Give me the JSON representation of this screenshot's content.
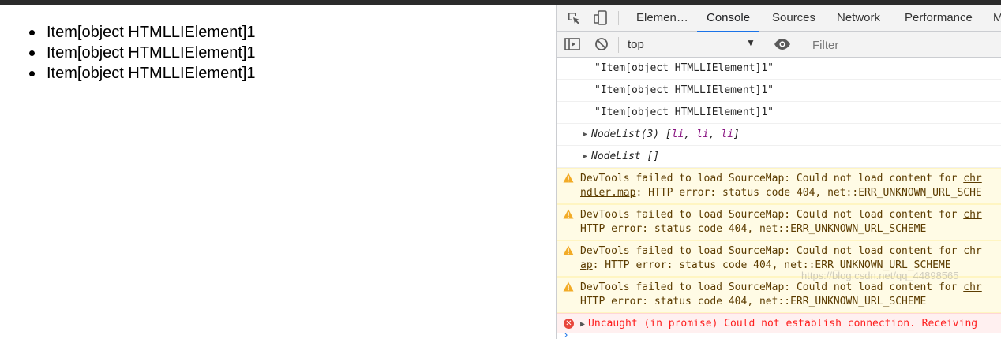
{
  "page": {
    "list_items": [
      "Item[object HTMLLIElement]1",
      "Item[object HTMLLIElement]1",
      "Item[object HTMLLIElement]1"
    ]
  },
  "devtools": {
    "tabs": [
      "Elemen…",
      "Console",
      "Sources",
      "Network",
      "Performance",
      "M"
    ],
    "active_tab": "Console",
    "context_selector": "top",
    "filter_placeholder": "Filter",
    "accent_color": "#1a73e8"
  },
  "console": {
    "strings": [
      "\"Item[object HTMLLIElement]1\"",
      "\"Item[object HTMLLIElement]1\"",
      "\"Item[object HTMLLIElement]1\""
    ],
    "nodelist1_prefix": "NodeList(3) [",
    "nodelist1_items": [
      "li",
      "li",
      "li"
    ],
    "nodelist1_suffix": "]",
    "nodelist2": "NodeList []",
    "warnings": [
      {
        "line1": "DevTools failed to load SourceMap: Could not load content for ",
        "line1_link": "chr",
        "line2_link": "ndler.map",
        "line2": ": HTTP error: status code 404, net::ERR_UNKNOWN_URL_SCHE"
      },
      {
        "line1": "DevTools failed to load SourceMap: Could not load content for ",
        "line1_link": "chr",
        "line2_link": "",
        "line2": "HTTP error: status code 404, net::ERR_UNKNOWN_URL_SCHEME"
      },
      {
        "line1": "DevTools failed to load SourceMap: Could not load content for ",
        "line1_link": "chr",
        "line2_link": "ap",
        "line2": ": HTTP error: status code 404, net::ERR_UNKNOWN_URL_SCHEME"
      },
      {
        "line1": "DevTools failed to load SourceMap: Could not load content for ",
        "line1_link": "chr",
        "line2_link": "",
        "line2": "HTTP error: status code 404, net::ERR_UNKNOWN_URL_SCHEME"
      }
    ],
    "error": "Uncaught (in promise) Could not establish connection. Receiving",
    "prompt_symbol": "›",
    "watermark": "https://blog.csdn.net/qq_44898565"
  },
  "icons": {
    "inspect": "inspect-element-icon",
    "device": "device-toolbar-icon",
    "sidebar": "console-sidebar-icon",
    "clear": "clear-console-icon",
    "eye": "live-expression-eye-icon",
    "warning": "warning-icon",
    "error": "error-icon"
  }
}
